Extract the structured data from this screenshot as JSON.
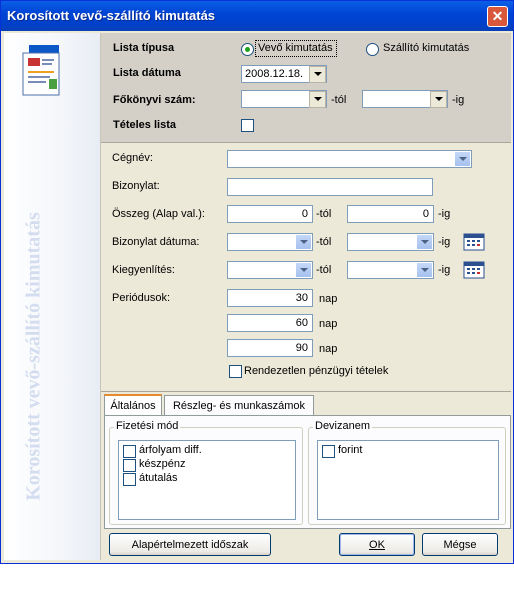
{
  "window": {
    "title": "Korosított vevő-szállító kimutatás"
  },
  "sidebar": {
    "vertical_text": "Korosított vevő-szállító kimutatás"
  },
  "top": {
    "lista_tipusa_label": "Lista típusa",
    "radio_vevo": "Vevő kimutatás",
    "radio_szallito": "Szállító kimutatás",
    "lista_datuma_label": "Lista dátuma",
    "lista_datuma_value": "2008.12.18.",
    "fokonyvi_label": "Főkönyvi szám:",
    "tol": "-tól",
    "ig": "-ig",
    "teteles_label": "Tételes lista"
  },
  "form": {
    "cegnev_label": "Cégnév:",
    "bizonylat_label": "Bizonylat:",
    "osszeg_label": "Összeg (Alap val.):",
    "osszeg_from": "0",
    "osszeg_to": "0",
    "tol": "-tól",
    "ig": "-ig",
    "bizonylat_datuma_label": "Bizonylat dátuma:",
    "kiegyenlites_label": "Kiegyenlítés:",
    "periodusok_label": "Periódusok:",
    "periods": [
      "30",
      "60",
      "90"
    ],
    "nap": "nap",
    "rendezetlen_label": "Rendezetlen pénzügyi tételek"
  },
  "tabs": [
    "Általános",
    "Részleg- és munkaszámok"
  ],
  "fizetesi": {
    "title": "Fizetési mód",
    "items": [
      "árfolyam diff.",
      "készpénz",
      "átutalás"
    ]
  },
  "devizanem": {
    "title": "Devizanem",
    "items": [
      "forint"
    ]
  },
  "buttons": {
    "default_period": "Alapértelmezett időszak",
    "ok": "OK",
    "cancel": "Mégse"
  },
  "colors": {
    "title_bar": "#0054e3",
    "header_panel": "#d4d0c8",
    "form_bg": "#ece9d8"
  }
}
